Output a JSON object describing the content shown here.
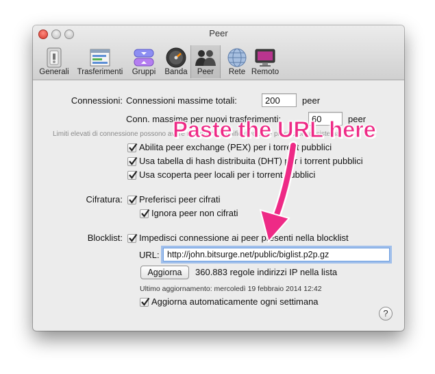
{
  "window": {
    "title": "Peer"
  },
  "toolbar": {
    "items": [
      {
        "label": "Generali",
        "icon": "general-switch-icon"
      },
      {
        "label": "Trasferimenti",
        "icon": "transfers-window-icon"
      },
      {
        "label": "Gruppi",
        "icon": "groups-arrows-icon"
      },
      {
        "label": "Banda",
        "icon": "bandwidth-speedometer-icon"
      },
      {
        "label": "Peer",
        "icon": "peers-people-icon",
        "selected": true
      },
      {
        "label": "Rete",
        "icon": "network-globe-icon"
      },
      {
        "label": "Remoto",
        "icon": "remote-display-icon"
      }
    ]
  },
  "connections": {
    "label": "Connessioni:",
    "max_total_label": "Connessioni massime totali:",
    "max_total_value": "200",
    "max_total_unit": "peer",
    "max_per_transfer_label": "Conn. massime per nuovi trasferimenti:",
    "max_per_transfer_value": "60",
    "max_per_transfer_unit": "peer",
    "warning": "Limiti elevati di connessione possono avere un impatto significativo sulle prestazioni di sistema",
    "pex_label": "Abilita peer exchange (PEX) per i torrent pubblici",
    "pex_checked": true,
    "dht_label": "Usa tabella di hash distribuita (DHT) per i torrent pubblici",
    "dht_checked": true,
    "lpd_label": "Usa scoperta peer locali per i torrent pubblici",
    "lpd_checked": true
  },
  "encryption": {
    "label": "Cifratura:",
    "prefer_label": "Preferisci peer cifrati",
    "prefer_checked": true,
    "ignore_label": "Ignora peer non cifrati",
    "ignore_checked": true
  },
  "blocklist": {
    "label": "Blocklist:",
    "prevent_label": "Impedisci connessione ai peer presenti nella blocklist",
    "prevent_checked": true,
    "url_label": "URL:",
    "url_value": "http://john.bitsurge.net/public/biglist.p2p.gz",
    "update_button": "Aggiorna",
    "rules_count": "360.883 regole indirizzi IP nella lista",
    "last_update": "Ultimo aggiornamento: mercoledì 19 febbraio 2014 12:42",
    "auto_update_label": "Aggiorna automaticamente ogni settimana",
    "auto_update_checked": true
  },
  "help_button": "?",
  "annotation": {
    "text": "Paste the URL here",
    "color": "#ee2a86"
  }
}
